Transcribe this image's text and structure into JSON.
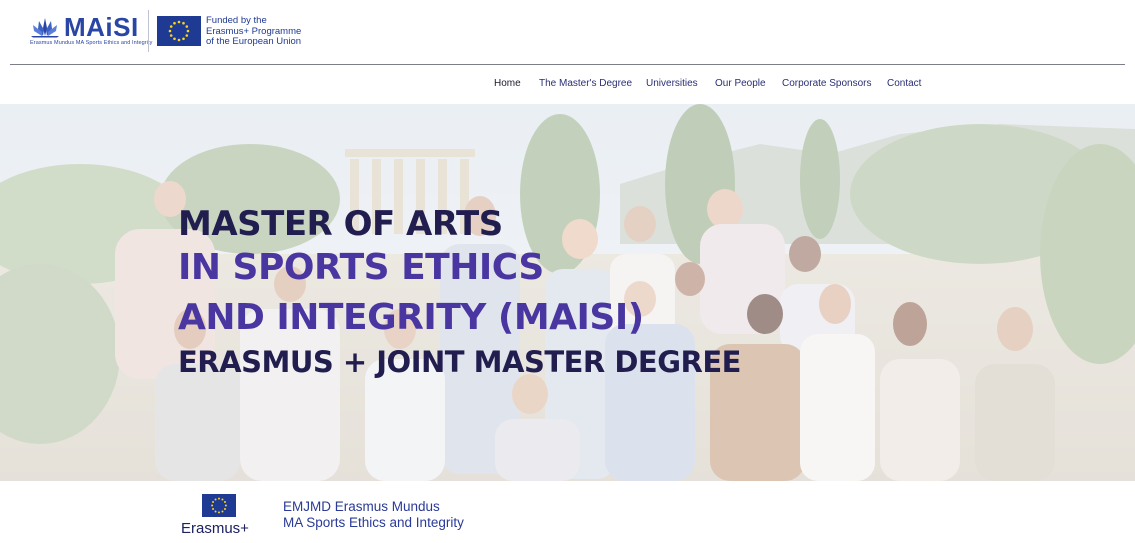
{
  "header": {
    "logo": {
      "name": "MAiSI",
      "tagline": "Erasmus Mundus MA Sports Ethics and Integrity",
      "icon": "lotus-icon"
    },
    "funding": {
      "line1": "Funded by the",
      "line2": "Erasmus+ Programme",
      "line3": "of the European Union",
      "flag_icon": "eu-flag-icon"
    }
  },
  "nav": {
    "items": [
      {
        "label": "Home",
        "active": true
      },
      {
        "label": "The Master's Degree",
        "active": false
      },
      {
        "label": "Universities",
        "active": false
      },
      {
        "label": "Our People",
        "active": false
      },
      {
        "label": "Corporate Sponsors",
        "active": false
      },
      {
        "label": "Contact",
        "active": false
      }
    ]
  },
  "hero": {
    "line1": "MASTER OF ARTS",
    "line2": "IN SPORTS ETHICS",
    "line3": "AND INTEGRITY (MAISI)",
    "line4": "ERASMUS + JOINT MASTER DEGREE"
  },
  "footer": {
    "emblem_label": "Erasmus+",
    "program_line1": "EMJMD Erasmus Mundus",
    "program_line2": "MA Sports Ethics and Integrity"
  },
  "colors": {
    "brand_blue": "#2a46a5",
    "eu_blue": "#1f3a93",
    "eu_yellow": "#ffd617",
    "title_dark": "#211d4f",
    "title_purple": "#4a36a0"
  }
}
